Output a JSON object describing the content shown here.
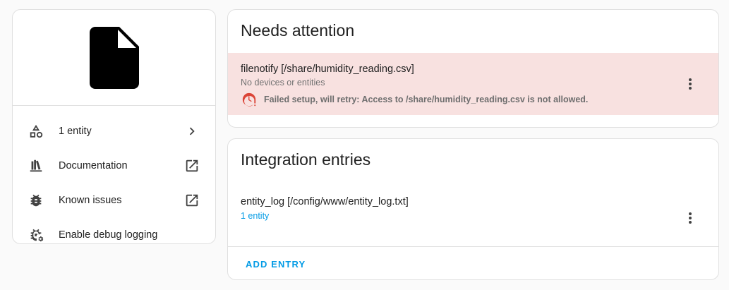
{
  "info_card": {
    "logo_icon": "file-document-icon",
    "items": [
      {
        "label": "1 entity",
        "icon": "shapes-icon",
        "end_icon": "chevron-right-icon"
      },
      {
        "label": "Documentation",
        "icon": "book-shelf-icon",
        "end_icon": "open-in-new-icon"
      },
      {
        "label": "Known issues",
        "icon": "bug-icon",
        "end_icon": "open-in-new-icon"
      },
      {
        "label": "Enable debug logging",
        "icon": "bug-settings-icon",
        "end_icon": ""
      }
    ]
  },
  "attention": {
    "title": "Needs attention",
    "entries": [
      {
        "title": "filenotify [/share/humidity_reading.csv]",
        "subtitle": "No devices or entities",
        "error": "Failed setup, will retry: Access to /share/humidity_reading.csv is not allowed.",
        "error_icon": "alert-clock-icon"
      }
    ]
  },
  "integration_entries": {
    "title": "Integration entries",
    "entries": [
      {
        "title": "entity_log [/config/www/entity_log.txt]",
        "link": "1 entity"
      }
    ],
    "add_label": "Add entry"
  },
  "colors": {
    "accent": "#039be5",
    "error_bg": "#f8e1e0",
    "error_icon": "#db4437"
  }
}
